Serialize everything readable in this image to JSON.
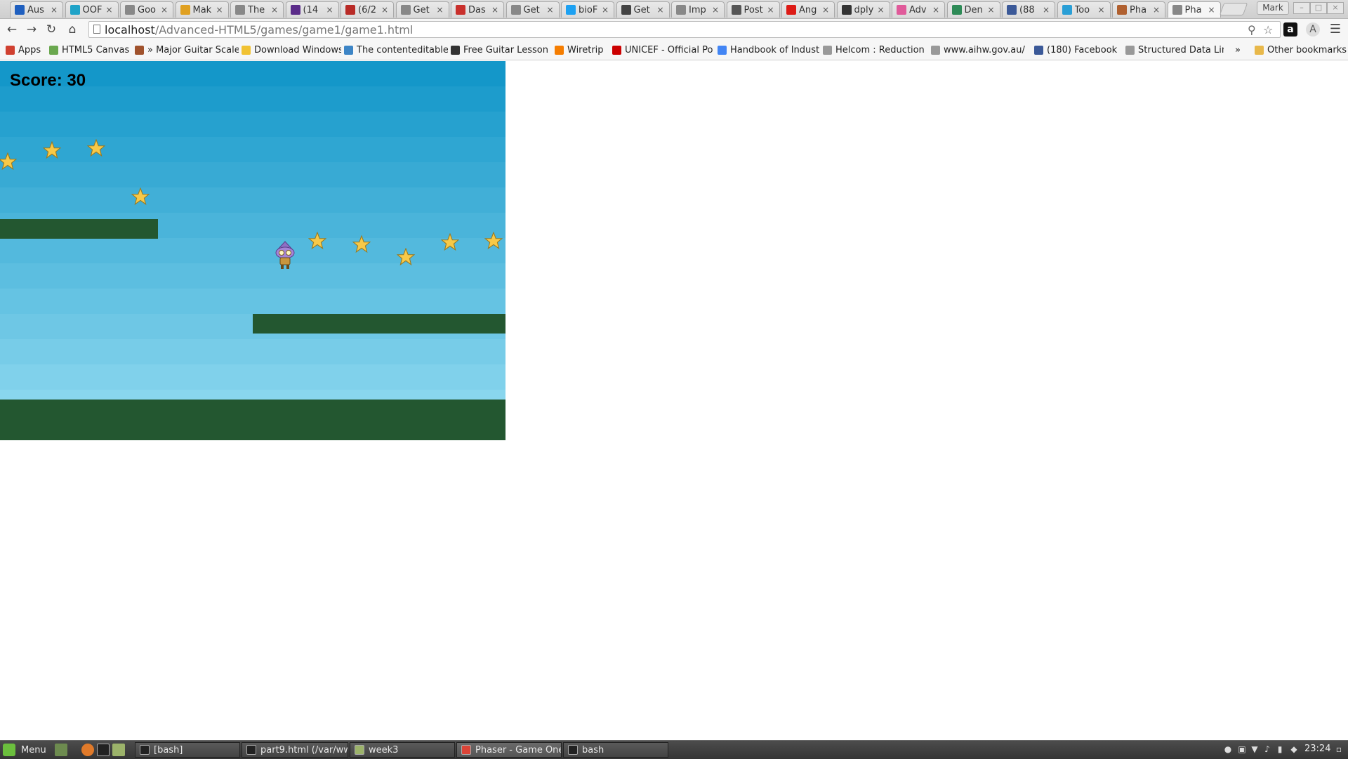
{
  "browser": {
    "tabs": [
      {
        "title": "Aus",
        "icon": "mozilla-icon",
        "color": "#1f5fbf"
      },
      {
        "title": "OOF",
        "icon": "js-icon",
        "color": "#1fa3c8"
      },
      {
        "title": "Goo",
        "icon": "page-icon",
        "color": "#888888"
      },
      {
        "title": "Mak",
        "icon": "tool-icon",
        "color": "#e0a020"
      },
      {
        "title": "The",
        "icon": "page-icon",
        "color": "#888888"
      },
      {
        "title": "(14",
        "icon": "mail-icon",
        "color": "#5b2c8a"
      },
      {
        "title": "(6/2",
        "icon": "quora-icon",
        "color": "#b92b27"
      },
      {
        "title": "Get",
        "icon": "page-icon",
        "color": "#888888"
      },
      {
        "title": "Das",
        "icon": "edx-icon",
        "color": "#c9302c"
      },
      {
        "title": "Get",
        "icon": "page-icon",
        "color": "#888888"
      },
      {
        "title": "bioF",
        "icon": "twitter-icon",
        "color": "#1da1f2"
      },
      {
        "title": "Get",
        "icon": "book-icon",
        "color": "#444444"
      },
      {
        "title": "Imp",
        "icon": "page-icon",
        "color": "#888888"
      },
      {
        "title": "Post",
        "icon": "diamond-icon",
        "color": "#555555"
      },
      {
        "title": "Ang",
        "icon": "angular-icon",
        "color": "#dd1b16"
      },
      {
        "title": "dply",
        "icon": "mu-icon",
        "color": "#333333"
      },
      {
        "title": "Adv",
        "icon": "flower-icon",
        "color": "#e05a9a"
      },
      {
        "title": "Den",
        "icon": "leaf-icon",
        "color": "#2e8b57"
      },
      {
        "title": "(88",
        "icon": "facebook-icon",
        "color": "#3b5998"
      },
      {
        "title": "Too",
        "icon": "tool-icon",
        "color": "#2a9fd6"
      },
      {
        "title": "Pha",
        "icon": "phaser-icon",
        "color": "#b06030"
      },
      {
        "title": "Pha",
        "icon": "page-icon",
        "color": "#888888"
      }
    ],
    "profile_name": "Mark",
    "url_host": "localhost",
    "url_path": "/Advanced-HTML5/games/game1/game1.html",
    "bookmarks": [
      {
        "label": "Apps",
        "icon": "apps-grid-icon",
        "color": "#d04030"
      },
      {
        "label": "HTML5 Canvas",
        "icon": "html5-icon",
        "color": "#6aa84f"
      },
      {
        "label": "» Major Guitar Scale",
        "icon": "guitar-icon",
        "color": "#a0522d"
      },
      {
        "label": "Download Windows",
        "icon": "bulb-icon",
        "color": "#f1c232"
      },
      {
        "label": "The contenteditable",
        "icon": "globe-icon",
        "color": "#3d85c6"
      },
      {
        "label": "Free Guitar Lesson",
        "icon": "pinwheel-icon",
        "color": "#333333"
      },
      {
        "label": "Wiretrip",
        "icon": "blogger-icon",
        "color": "#f57d00"
      },
      {
        "label": "UNICEF - Official Po",
        "icon": "unicef-icon",
        "color": "#cc0000"
      },
      {
        "label": "Handbook of Indust",
        "icon": "google-icon",
        "color": "#4285f4"
      },
      {
        "label": "Helcom : Reduction",
        "icon": "page-icon",
        "color": "#999999"
      },
      {
        "label": "www.aihw.gov.au/",
        "icon": "page-icon",
        "color": "#999999"
      },
      {
        "label": "(180) Facebook",
        "icon": "facebook-icon",
        "color": "#3b5998"
      },
      {
        "label": "Structured Data Lin",
        "icon": "page-icon",
        "color": "#999999"
      },
      {
        "label": "»",
        "icon": "overflow-icon",
        "color": "#444444"
      },
      {
        "label": "Other bookmarks",
        "icon": "folder-icon",
        "color": "#e8b84a"
      }
    ]
  },
  "game": {
    "score_label": "Score: 30",
    "colors": {
      "sky_top": "#1497c9",
      "sky_bottom": "#89d6ee",
      "ground": "#235730",
      "star": "#f7c948"
    }
  },
  "taskbar": {
    "menu_label": "Menu",
    "tasks": [
      {
        "label": "[bash]",
        "icon": "terminal-icon"
      },
      {
        "label": "part9.html (/var/ww...",
        "icon": "terminal-icon"
      },
      {
        "label": "week3",
        "icon": "folder-icon"
      },
      {
        "label": "Phaser - Game One...",
        "icon": "chrome-icon"
      },
      {
        "label": "bash",
        "icon": "terminal-icon"
      }
    ],
    "clock": "23:24"
  }
}
